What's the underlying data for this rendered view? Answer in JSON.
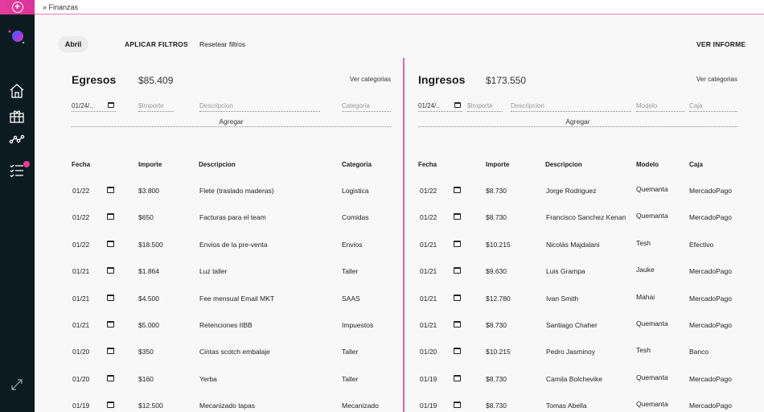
{
  "breadcrumb": "» Finanzas",
  "toolbar": {
    "month_chip": "Abril",
    "apply_filters": "APLICAR FILTROS",
    "reset_filters": "Resetear filtros",
    "view_report": "VER INFORME"
  },
  "egresos": {
    "title": "Egresos",
    "total": "$85.409",
    "categories_link": "Ver categorias",
    "form": {
      "date_value": "01/24/..",
      "importe_placeholder": "$Importe",
      "descripcion_placeholder": "Descripcion",
      "categoria_placeholder": "Categoria",
      "add_label": "Agregar"
    },
    "columns": [
      "Fecha",
      "Importe",
      "Descripcion",
      "Categoria"
    ],
    "rows": [
      {
        "fecha": "01/22",
        "importe": "$3.800",
        "descripcion": "Flete (traslado maderas)",
        "categoria": "Logistica"
      },
      {
        "fecha": "01/22",
        "importe": "$650",
        "descripcion": "Facturas para el team",
        "categoria": "Comidas"
      },
      {
        "fecha": "01/22",
        "importe": "$18.500",
        "descripcion": "Envios de la  pre-venta",
        "categoria": "Envios"
      },
      {
        "fecha": "01/21",
        "importe": "$1.864",
        "descripcion": "Luz taller",
        "categoria": "Taller"
      },
      {
        "fecha": "01/21",
        "importe": "$4.500",
        "descripcion": "Fee mensual Email MKT",
        "categoria": "SAAS"
      },
      {
        "fecha": "01/21",
        "importe": "$5.000",
        "descripcion": "Retenciones IIBB",
        "categoria": "Impuestos"
      },
      {
        "fecha": "01/20",
        "importe": "$350",
        "descripcion": "Cintas scotch embalaje",
        "categoria": "Taller"
      },
      {
        "fecha": "01/20",
        "importe": "$160",
        "descripcion": "Yerba",
        "categoria": "Taller"
      },
      {
        "fecha": "01/19",
        "importe": "$12.500",
        "descripcion": "Mecanizado tapas",
        "categoria": "Mecanizado"
      }
    ]
  },
  "ingresos": {
    "title": "Ingresos",
    "total": "$173.550",
    "categories_link": "Ver categorias",
    "form": {
      "date_value": "01/24/..",
      "importe_placeholder": "$Importe",
      "descripcion_placeholder": "Descripcion",
      "modelo_placeholder": "Modelo",
      "caja_placeholder": "Caja",
      "add_label": "Agregar"
    },
    "columns": [
      "Fecha",
      "Importe",
      "Descripcion",
      "Modelo",
      "Caja"
    ],
    "rows": [
      {
        "fecha": "01/22",
        "importe": "$8.730",
        "descripcion": "Jorge Rodriguez",
        "modelo": "Quemanta",
        "caja": "MercadoPago"
      },
      {
        "fecha": "01/22",
        "importe": "$8.730",
        "descripcion": "Francisco Sanchez Kenan",
        "modelo": "Quemanta",
        "caja": "MercadoPago"
      },
      {
        "fecha": "01/21",
        "importe": "$10.215",
        "descripcion": "Nicolás Majdalani",
        "modelo": "Tesh",
        "caja": "Efectivo"
      },
      {
        "fecha": "01/21",
        "importe": "$9.630",
        "descripcion": "Luis Grampa",
        "modelo": "Jauke",
        "caja": "MercadoPago"
      },
      {
        "fecha": "01/21",
        "importe": "$12.780",
        "descripcion": "Ivan Smith",
        "modelo": "Mahai",
        "caja": "MercadoPago"
      },
      {
        "fecha": "01/21",
        "importe": "$8.730",
        "descripcion": "Santiago Chaher",
        "modelo": "Quemanta",
        "caja": "MercadoPago"
      },
      {
        "fecha": "01/20",
        "importe": "$10.215",
        "descripcion": "Pedro Jasminoy",
        "modelo": "Tesh",
        "caja": "Banco"
      },
      {
        "fecha": "01/19",
        "importe": "$8.730",
        "descripcion": "Camila Bolchevike",
        "modelo": "Quemanta",
        "caja": "MercadoPago"
      },
      {
        "fecha": "01/19",
        "importe": "$8.730",
        "descripcion": "Tomas Abella",
        "modelo": "Quemanta",
        "caja": "MercadoPago"
      }
    ]
  },
  "icons": {
    "add": "plus-circle-icon",
    "logo": "brand-logo",
    "nav": [
      "home-icon",
      "gift-icon",
      "analytics-icon",
      "tasks-icon"
    ],
    "expand": "expand-arrows-icon",
    "date": "calendar-icon"
  },
  "colors": {
    "accent": "#e53c9c",
    "sidebar": "#0c1b20"
  }
}
